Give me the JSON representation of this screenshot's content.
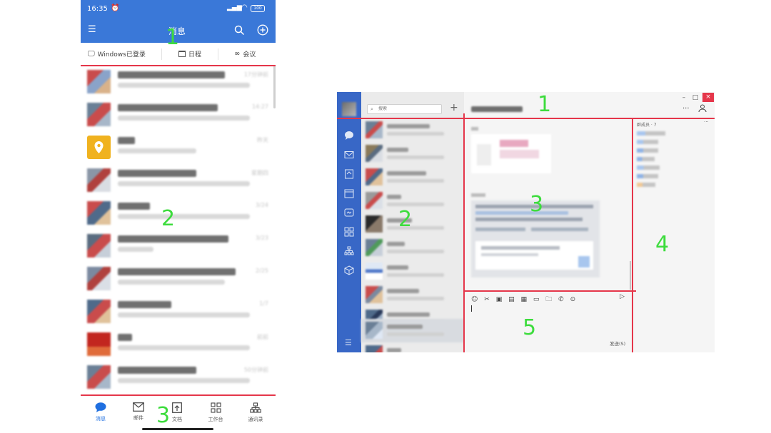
{
  "phone": {
    "status": {
      "time": "16:35",
      "battery": "100"
    },
    "header": {
      "title": "消息"
    },
    "tabs": [
      {
        "label": "Windows已登录",
        "icon": "monitor-icon"
      },
      {
        "label": "日程",
        "icon": "calendar-icon"
      },
      {
        "label": "会议",
        "icon": "meeting-icon"
      }
    ],
    "chats": [
      {
        "time": "17分钟前",
        "thumb": [
          "#c94c4c",
          "#8aa3c9",
          "#d9b28a"
        ]
      },
      {
        "time": "14:27",
        "thumb": [
          "#6a7f96",
          "#c94c4c",
          "#a7b7c9"
        ]
      },
      {
        "time": "昨天",
        "thumb": [
          "#f0b21f",
          "#f0b21f",
          "#ffffff"
        ]
      },
      {
        "time": "星期四",
        "thumb": [
          "#8a96a6",
          "#b0413e",
          "#d9dde3"
        ]
      },
      {
        "time": "3/24",
        "thumb": [
          "#c94c4c",
          "#4f6a8a",
          "#e0c29b"
        ]
      },
      {
        "time": "3/23",
        "thumb": [
          "#5a6c80",
          "#c94c4c",
          "#c7cfd9"
        ]
      },
      {
        "time": "2/25",
        "thumb": [
          "#7b8aa0",
          "#b0413e",
          "#dadfe6"
        ]
      },
      {
        "time": "1/7",
        "thumb": [
          "#4f6a8a",
          "#c94c4c",
          "#e0c29b"
        ]
      },
      {
        "time": "前前",
        "thumb": [
          "#c2261f",
          "#c2261f",
          "#e06b3a"
        ]
      },
      {
        "time": "50分钟前",
        "thumb": [
          "#6a7f96",
          "#c94c4c",
          "#a7b7c9"
        ]
      }
    ],
    "bottom_nav": [
      {
        "label": "消息",
        "icon": "chat-bubble-icon",
        "active": true
      },
      {
        "label": "邮件",
        "icon": "mail-icon",
        "active": false
      },
      {
        "label": "文档",
        "icon": "document-icon",
        "active": false
      },
      {
        "label": "工作台",
        "icon": "grid-icon",
        "active": false
      },
      {
        "label": "通讯录",
        "icon": "org-chart-icon",
        "active": false
      }
    ],
    "zones": [
      "1",
      "2",
      "3"
    ]
  },
  "desktop": {
    "search_placeholder": "搜索",
    "members_label": "群成员 · 7",
    "send_label": "发送(S)",
    "zones": [
      "1",
      "2",
      "3",
      "4",
      "5"
    ]
  },
  "colors": {
    "accent_blue": "#3a78d8",
    "nav_blue": "#3867c6",
    "divider_red": "#e5364a",
    "zone_green": "#3ddc3d"
  }
}
